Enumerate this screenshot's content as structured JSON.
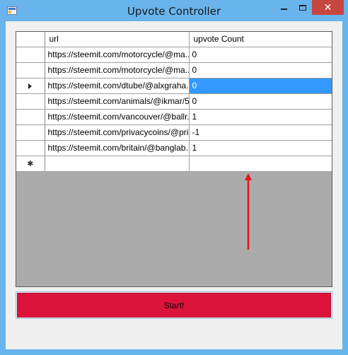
{
  "window": {
    "title": "Upvote Controller",
    "close_glyph": "✕",
    "accent_color": "#69b4ec"
  },
  "grid": {
    "columns": [
      "url",
      "upvote Count"
    ],
    "rows": [
      {
        "url": "https://steemit.com/motorcycle/@ma...",
        "count": "0"
      },
      {
        "url": "https://steemit.com/motorcycle/@ma...",
        "count": "0"
      },
      {
        "url": "https://steemit.com/dtube/@alxgraha...",
        "count": "0"
      },
      {
        "url": "https://steemit.com/animals/@ikmar/5...",
        "count": "0"
      },
      {
        "url": "https://steemit.com/vancouver/@ballr...",
        "count": "1"
      },
      {
        "url": "https://steemit.com/privacycoins/@pri...",
        "count": "-1"
      },
      {
        "url": "https://steemit.com/britain/@banglab...",
        "count": "1"
      }
    ],
    "current_row_marker": "current-row-icon",
    "new_row_marker": "✱",
    "selection_color": "#3399ff"
  },
  "start_button": {
    "label": "Start!",
    "color": "#dc143c"
  },
  "annotation": {
    "arrow_color": "#e8141e"
  }
}
